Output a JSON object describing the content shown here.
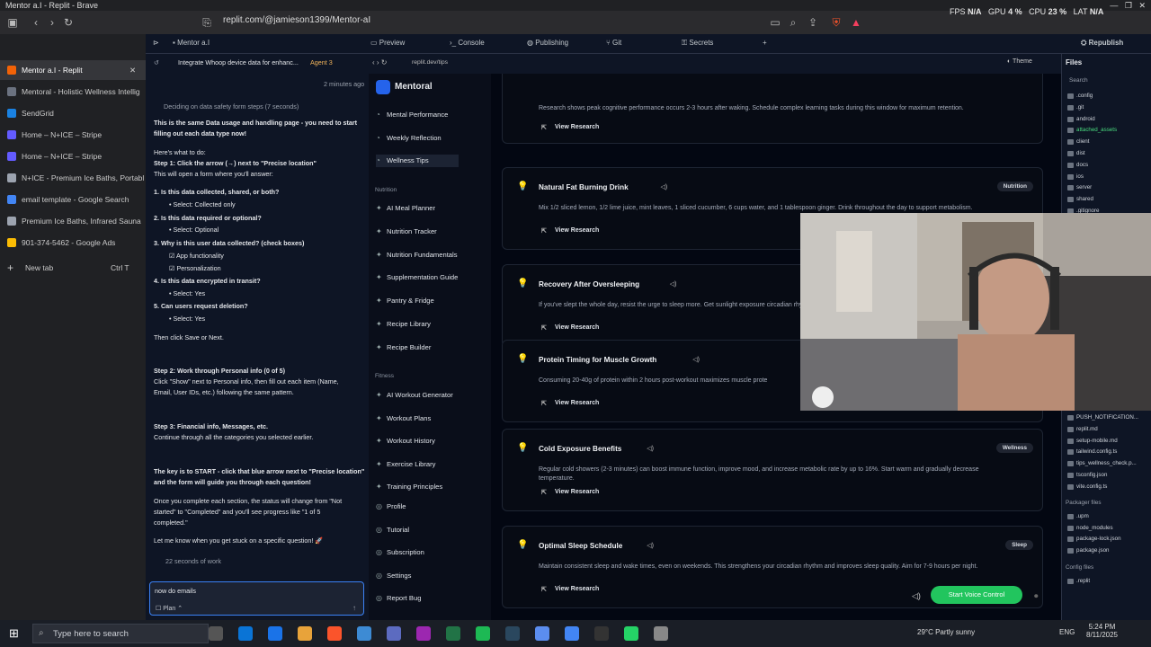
{
  "window": {
    "title": "Mentor a.I - Replit - Brave"
  },
  "browser": {
    "url": "replit.com/@jamieson1399/Mentor-aI",
    "perf": {
      "fps_label": "FPS",
      "fps": "N/A",
      "gpu_label": "GPU",
      "gpu": "4 %",
      "cpu_label": "CPU",
      "cpu": "23 %",
      "lat_label": "LAT",
      "lat": "N/A"
    },
    "tabs": [
      {
        "label": "Mentor a.I - Replit",
        "color": "#f26207"
      },
      {
        "label": "Mentoral - Holistic Wellness Intellig",
        "color": "#6b7280"
      },
      {
        "label": "SendGrid",
        "color": "#1a82e2"
      },
      {
        "label": "Home – N+ICE – Stripe",
        "color": "#635bff"
      },
      {
        "label": "Home – N+ICE – Stripe",
        "color": "#635bff"
      },
      {
        "label": "N+ICE - Premium Ice Baths, Portabl",
        "color": "#9ca3af"
      },
      {
        "label": "email template - Google Search",
        "color": "#4285f4"
      },
      {
        "label": "Premium Ice Baths, Infrared Sauna",
        "color": "#9ca3af"
      },
      {
        "label": "901-374-5462 - Google Ads",
        "color": "#fbbc04"
      }
    ],
    "new_tab": "New tab",
    "new_tab_shortcut": "Ctrl  T"
  },
  "replit": {
    "project_tab": "Mentor a.I",
    "tabs": {
      "preview": "Preview",
      "console": "Console",
      "publishing": "Publishing",
      "git": "Git",
      "secrets": "Secrets"
    },
    "republish": "Republish",
    "files_label": "Files",
    "thread_title": "Integrate Whoop device data for enhanc...",
    "agent_badge": "Agent 3",
    "timestamp": "2 minutes ago",
    "preview_url": "replit.dev/tips",
    "theme_label": "Theme",
    "search_placeholder": "Search"
  },
  "agent": {
    "lines": [
      {
        "t": "Deciding on data safety form steps (7 seconds)",
        "s": "dim"
      },
      {
        "t": "This is the same Data usage and handling page - you need to start",
        "s": "b"
      },
      {
        "t": "filling out each data type now!",
        "s": "b"
      },
      {
        "t": "Here's what to do:",
        "s": ""
      },
      {
        "t": "Step 1: Click the arrow (→) next to \"Precise location\"",
        "s": "b"
      },
      {
        "t": "This will open a form where you'll answer:",
        "s": ""
      },
      {
        "t": "1. Is this data collected, shared, or both?",
        "s": "b"
      },
      {
        "t": "• Select: Collected only",
        "s": "i"
      },
      {
        "t": "2. Is this data required or optional?",
        "s": "b"
      },
      {
        "t": "• Select: Optional",
        "s": "i"
      },
      {
        "t": "3. Why is this user data collected? (check boxes)",
        "s": "b"
      },
      {
        "t": "☑ App functionality",
        "s": "i"
      },
      {
        "t": "☑ Personalization",
        "s": "i"
      },
      {
        "t": "4. Is this data encrypted in transit?",
        "s": "b"
      },
      {
        "t": "• Select: Yes",
        "s": "i"
      },
      {
        "t": "5. Can users request deletion?",
        "s": "b"
      },
      {
        "t": "• Select: Yes",
        "s": "i"
      },
      {
        "t": "Then click Save or Next.",
        "s": ""
      },
      {
        "t": "Step 2: Work through Personal info (0 of 5)",
        "s": "b"
      },
      {
        "t": "Click \"Show\" next to Personal info, then fill out each item (Name,",
        "s": ""
      },
      {
        "t": "Email, User IDs, etc.) following the same pattern.",
        "s": ""
      },
      {
        "t": "Step 3: Financial info, Messages, etc.",
        "s": "b"
      },
      {
        "t": "Continue through all the categories you selected earlier.",
        "s": ""
      },
      {
        "t": "The key is to START - click that blue arrow next to \"Precise location\"",
        "s": "b"
      },
      {
        "t": "and the form will guide you through each question!",
        "s": "b"
      },
      {
        "t": "Once you complete each section, the status will change from \"Not",
        "s": ""
      },
      {
        "t": "started\" to \"Completed\" and you'll see progress like \"1 of 5",
        "s": ""
      },
      {
        "t": "completed.\"",
        "s": ""
      },
      {
        "t": "Let me know when you get stuck on a specific question! 🚀",
        "s": ""
      }
    ],
    "work_time": "22 seconds of work",
    "input_value": "now do emails",
    "plan_label": "Plan"
  },
  "mentoral": {
    "brand": "Mentoral",
    "nav_top": [
      "Mental Performance",
      "Weekly Reflection",
      "Wellness Tips"
    ],
    "section_nutrition": "Nutrition",
    "nav_nutrition": [
      "AI Meal Planner",
      "Nutrition Tracker",
      "Nutrition Fundamentals",
      "Supplementation Guide",
      "Pantry & Fridge",
      "Recipe Library",
      "Recipe Builder"
    ],
    "section_fitness": "Fitness",
    "nav_fitness": [
      "AI Workout Generator",
      "Workout Plans",
      "Workout History",
      "Exercise Library",
      "Training Principles"
    ],
    "nav_bottom": [
      "Profile",
      "Tutorial",
      "Subscription",
      "Settings",
      "Report Bug"
    ],
    "view_research": "View Research",
    "top_card_desc": "Research shows peak cognitive performance occurs 2-3 hours after waking. Schedule complex learning tasks during this window for maximum retention.",
    "cards": [
      {
        "title": "Natural Fat Burning Drink",
        "badge": "Nutrition",
        "desc": "Mix 1/2 sliced lemon, 1/2 lime juice, mint leaves, 1 sliced cucumber, 6 cups water, and 1 tablespoon ginger. Drink throughout the day to support metabolism."
      },
      {
        "title": "Recovery After Oversleeping",
        "badge": "",
        "desc": "If you've slept the whole day, resist the urge to sleep more. Get sunlight exposure circadian rhythm."
      },
      {
        "title": "Protein Timing for Muscle Growth",
        "badge": "",
        "desc": "Consuming 20-40g of protein within 2 hours post-workout maximizes muscle prote"
      },
      {
        "title": "Cold Exposure Benefits",
        "badge": "Wellness",
        "desc": "Regular cold showers (2-3 minutes) can boost immune function, improve mood, and increase metabolic rate by up to 16%. Start warm and gradually decrease temperature."
      },
      {
        "title": "Optimal Sleep Schedule",
        "badge": "Sleep",
        "desc": "Maintain consistent sleep and wake times, even on weekends. This strengthens your circadian rhythm and improves sleep quality. Aim for 7-9 hours per night."
      }
    ],
    "voice_button": "Start Voice Control"
  },
  "files": {
    "top": [
      ".config",
      ".git",
      "android",
      "attached_assets",
      "client",
      "dist",
      "docs",
      "ios",
      "server",
      "shared",
      ".gitignore"
    ],
    "bottom": [
      "PUSH_NOTIFICATION...",
      "replit.md",
      "setup-mobile.md",
      "tailwind.config.ts",
      "tips_wellness_check.p...",
      "tsconfig.json",
      "vite.config.ts"
    ],
    "packager_label": "Packager files",
    "packager": [
      ".upm",
      "node_modules",
      "package-lock.json",
      "package.json"
    ],
    "config_label": "Config files",
    "config": [
      ".replit"
    ]
  },
  "taskbar": {
    "search_placeholder": "Type here to search",
    "weather": "29°C  Partly sunny",
    "lang": "ENG",
    "time": "5:24 PM",
    "date": "8/11/2025"
  }
}
